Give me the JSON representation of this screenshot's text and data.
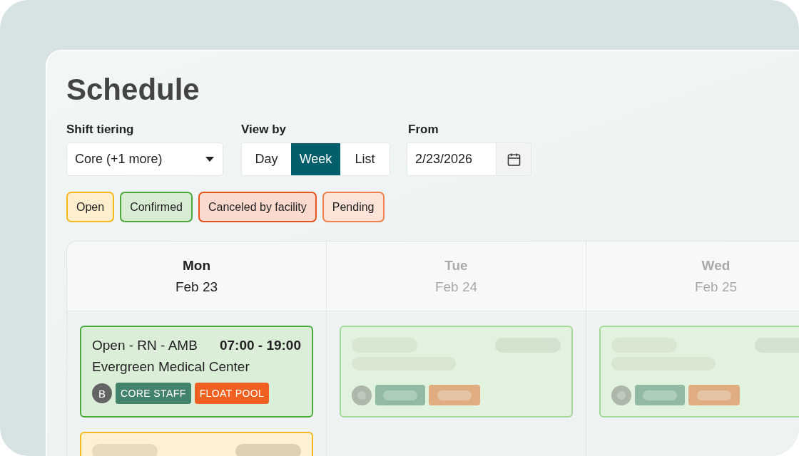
{
  "page": {
    "title": "Schedule"
  },
  "filters": {
    "shift_tiering": {
      "label": "Shift tiering",
      "value": "Core (+1 more)"
    },
    "view_by": {
      "label": "View by",
      "options": [
        {
          "label": "Day",
          "selected": false
        },
        {
          "label": "Week",
          "selected": true
        },
        {
          "label": "List",
          "selected": false
        }
      ]
    },
    "from": {
      "label": "From",
      "value": "2/23/2026"
    }
  },
  "legend": [
    {
      "label": "Open",
      "color": "#f5b820"
    },
    {
      "label": "Confirmed",
      "color": "#4caa3c"
    },
    {
      "label": "Canceled by facility",
      "color": "#e8541e"
    },
    {
      "label": "Pending",
      "color": "#f0804e"
    }
  ],
  "calendar": {
    "days": [
      {
        "name": "Mon",
        "date": "Feb 23",
        "active": true,
        "shifts": [
          {
            "kind": "shift",
            "color": "#4caa3c",
            "title": "Open - RN - AMB",
            "time": "07:00 - 19:00",
            "facility": "Evergreen Medical Center",
            "assignee_initial": "B",
            "tags": [
              {
                "label": "CORE STAFF",
                "color": "#43826b"
              },
              {
                "label": "FLOAT POOL",
                "color": "#f06020"
              }
            ]
          },
          {
            "kind": "stub",
            "color": "#f5b820"
          }
        ]
      },
      {
        "name": "Tue",
        "date": "Feb 24",
        "active": false,
        "shifts": [
          {
            "kind": "placeholder",
            "color": "#a5d89a"
          }
        ]
      },
      {
        "name": "Wed",
        "date": "Feb 25",
        "active": false,
        "shifts": [
          {
            "kind": "placeholder",
            "color": "#a5d89a"
          }
        ]
      }
    ]
  }
}
